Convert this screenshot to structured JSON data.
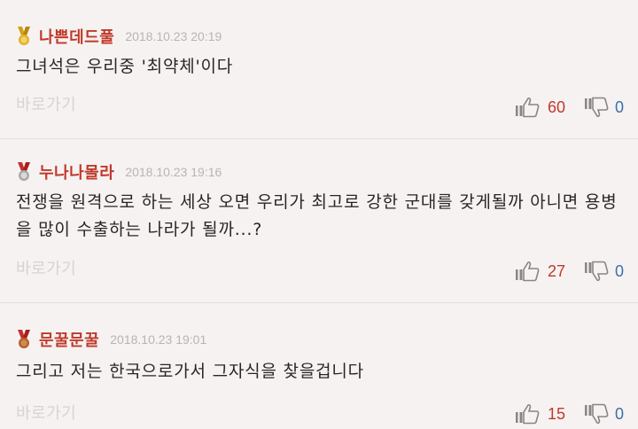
{
  "comments": [
    {
      "username": "나쁜데드풀",
      "timestamp": "2018.10.23 20:19",
      "text": "그녀석은 우리중 '최약체'이다",
      "reply_label": "바로가기",
      "likes": "60",
      "dislikes": "0",
      "medal": "gold-medal-icon"
    },
    {
      "username": "누나나몰라",
      "timestamp": "2018.10.23 19:16",
      "text": "전쟁을 원격으로 하는 세상 오면 우리가 최고로 강한 군대를 갖게될까 아니면 용병을 많이 수출하는 나라가 될까...?",
      "reply_label": "바로가기",
      "likes": "27",
      "dislikes": "0",
      "medal": "silver-medal-icon"
    },
    {
      "username": "문꿀문꿀",
      "timestamp": "2018.10.23 19:01",
      "text": "그리고 저는 한국으로가서 그자식을 찾을겁니다",
      "reply_label": "바로가기",
      "likes": "15",
      "dislikes": "0",
      "medal": "bronze-medal-icon"
    }
  ],
  "colors": {
    "background": "#f6f2f1",
    "username": "#c0392b",
    "like_count": "#c0392b",
    "dislike_count": "#3b6fae",
    "timestamp": "#b9b4b3",
    "reply_link": "#d8d3d2"
  }
}
